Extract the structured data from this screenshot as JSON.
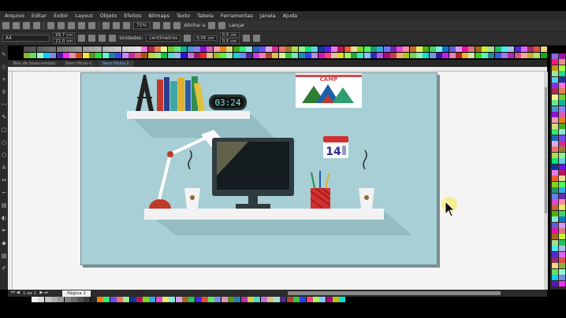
{
  "menubar": {
    "items": [
      "Arquivo",
      "Editar",
      "Exibir",
      "Layout",
      "Objeto",
      "Efeitos",
      "Bitmaps",
      "Texto",
      "Tabela",
      "Ferramentas",
      "Janela",
      "Ajuda"
    ]
  },
  "toolbar1": {
    "zoom": "75%",
    "snap_label": "Alinhar a",
    "launch_label": "Lançar"
  },
  "toolbar2": {
    "page_size": "A4",
    "width": "29,7 cm",
    "height": "21,0 cm",
    "units_label": "Unidades:",
    "units_value": "centímetros",
    "nudge": "0,05 cm",
    "dup_x": "0,5 cm",
    "dup_y": "0,5 cm"
  },
  "tabs": [
    "Tela de boas-vindas",
    "Sem título-1",
    "Sem título-2"
  ],
  "statusbar": {
    "page_of": "1  de  1",
    "page_tab": "Página 1"
  },
  "artwork": {
    "clock_text": "03:24",
    "poster_text": "CAMP",
    "calendar_day": "14"
  },
  "colors": {
    "canvas_bg": "#a7cfd5",
    "shelf": "#f2f2f2",
    "lamp": "#ffffff",
    "lamp_base": "#c0392b",
    "monitor": "#2f3b40",
    "accent_tab": "#6fb6ff"
  }
}
